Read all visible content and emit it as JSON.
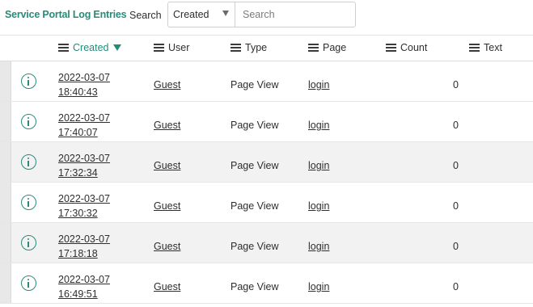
{
  "title": "Service Portal Log Entries",
  "search": {
    "label": "Search",
    "field_selected": "Created",
    "placeholder": "Search"
  },
  "columns": {
    "created": "Created",
    "user": "User",
    "type": "Type",
    "page": "Page",
    "count": "Count",
    "text": "Text"
  },
  "sorted_column": "Created",
  "sort_direction": "descending",
  "accent_color": "#278b79",
  "rows": [
    {
      "date": "2022-03-07",
      "time": "18:40:43",
      "user": "Guest",
      "type": "Page View",
      "page": "login",
      "count": "0",
      "text": ""
    },
    {
      "date": "2022-03-07",
      "time": "17:40:07",
      "user": "Guest",
      "type": "Page View",
      "page": "login",
      "count": "0",
      "text": ""
    },
    {
      "date": "2022-03-07",
      "time": "17:32:34",
      "user": "Guest",
      "type": "Page View",
      "page": "login",
      "count": "0",
      "text": ""
    },
    {
      "date": "2022-03-07",
      "time": "17:30:32",
      "user": "Guest",
      "type": "Page View",
      "page": "login",
      "count": "0",
      "text": ""
    },
    {
      "date": "2022-03-07",
      "time": "17:18:18",
      "user": "Guest",
      "type": "Page View",
      "page": "login",
      "count": "0",
      "text": ""
    },
    {
      "date": "2022-03-07",
      "time": "16:49:51",
      "user": "Guest",
      "type": "Page View",
      "page": "login",
      "count": "0",
      "text": ""
    }
  ]
}
